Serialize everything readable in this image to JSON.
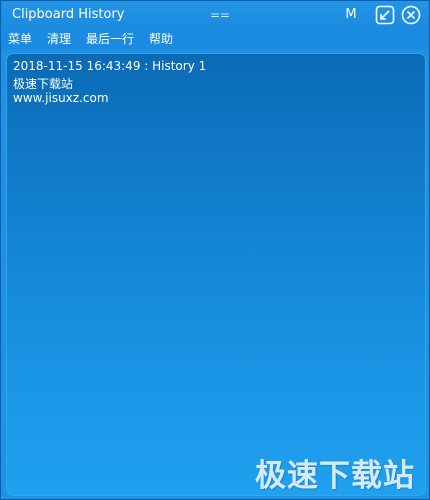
{
  "titlebar": {
    "title": "Clipboard History",
    "center_mark": "==",
    "m_button": "M",
    "pin_icon": "pin-icon",
    "close_icon": "close-icon"
  },
  "menu": {
    "items": [
      {
        "label": "菜单"
      },
      {
        "label": "清理"
      },
      {
        "label": "最后一行"
      },
      {
        "label": "帮助"
      }
    ]
  },
  "content": {
    "entry_header": "2018-11-15 16:43:49 : History 1",
    "entry_lines": [
      "极速下载站",
      "www.jisuxz.com"
    ]
  },
  "watermark": "极速下载站",
  "colors": {
    "window_bg": "#1e93e6",
    "content_top": "#0b6ab5",
    "content_bottom": "#20a0ee",
    "text": "#ffffff"
  }
}
